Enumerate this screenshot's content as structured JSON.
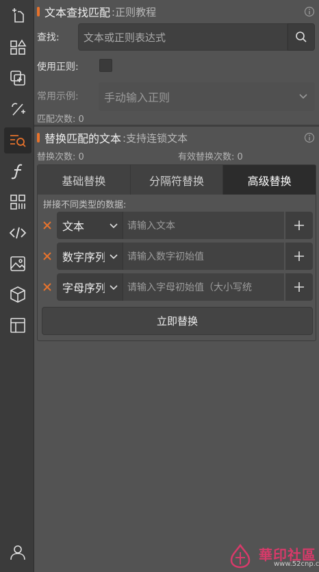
{
  "sidebar": {
    "items": [
      {
        "icon": "add-page-icon"
      },
      {
        "icon": "shapes-icon"
      },
      {
        "icon": "copy-add-icon"
      },
      {
        "icon": "magic-wand-icon"
      },
      {
        "icon": "text-search-icon",
        "active": true
      },
      {
        "icon": "function-icon"
      },
      {
        "icon": "grid-icon"
      },
      {
        "icon": "code-icon"
      },
      {
        "icon": "image-icon"
      },
      {
        "icon": "cube-icon"
      },
      {
        "icon": "layout-icon"
      }
    ],
    "user_icon": "user-icon"
  },
  "find_section": {
    "title": "文本查找匹配",
    "subtitle": ":正则教程",
    "find_label": "查找:",
    "find_placeholder": "文本或正则表达式",
    "regex_label": "使用正则:",
    "examples_label": "常用示例:",
    "examples_value": "手动输入正则",
    "match_count": "匹配次数: 0"
  },
  "replace_section": {
    "title": "替换匹配的文本",
    "subtitle": ":支持连锁文本",
    "replace_count": "替换次数: 0",
    "effective_count": "有效替换次数: 0",
    "tabs": [
      "基础替换",
      "分隔符替换",
      "高级替换"
    ],
    "active_tab": 2,
    "concat_label": "拼接不同类型的数据:",
    "rows": [
      {
        "type": "文本",
        "placeholder": "请输入文本"
      },
      {
        "type": "数字序列",
        "placeholder": "请输入数字初始值"
      },
      {
        "type": "字母序列",
        "placeholder": "请输入字母初始值（大小写统"
      }
    ],
    "apply_button": "立即替换"
  },
  "watermark": {
    "text": "華印社區",
    "url": "www.52cnp.com"
  },
  "colors": {
    "accent": "#e8732c",
    "background": "#535353",
    "sidebar": "#3b3b3b"
  }
}
